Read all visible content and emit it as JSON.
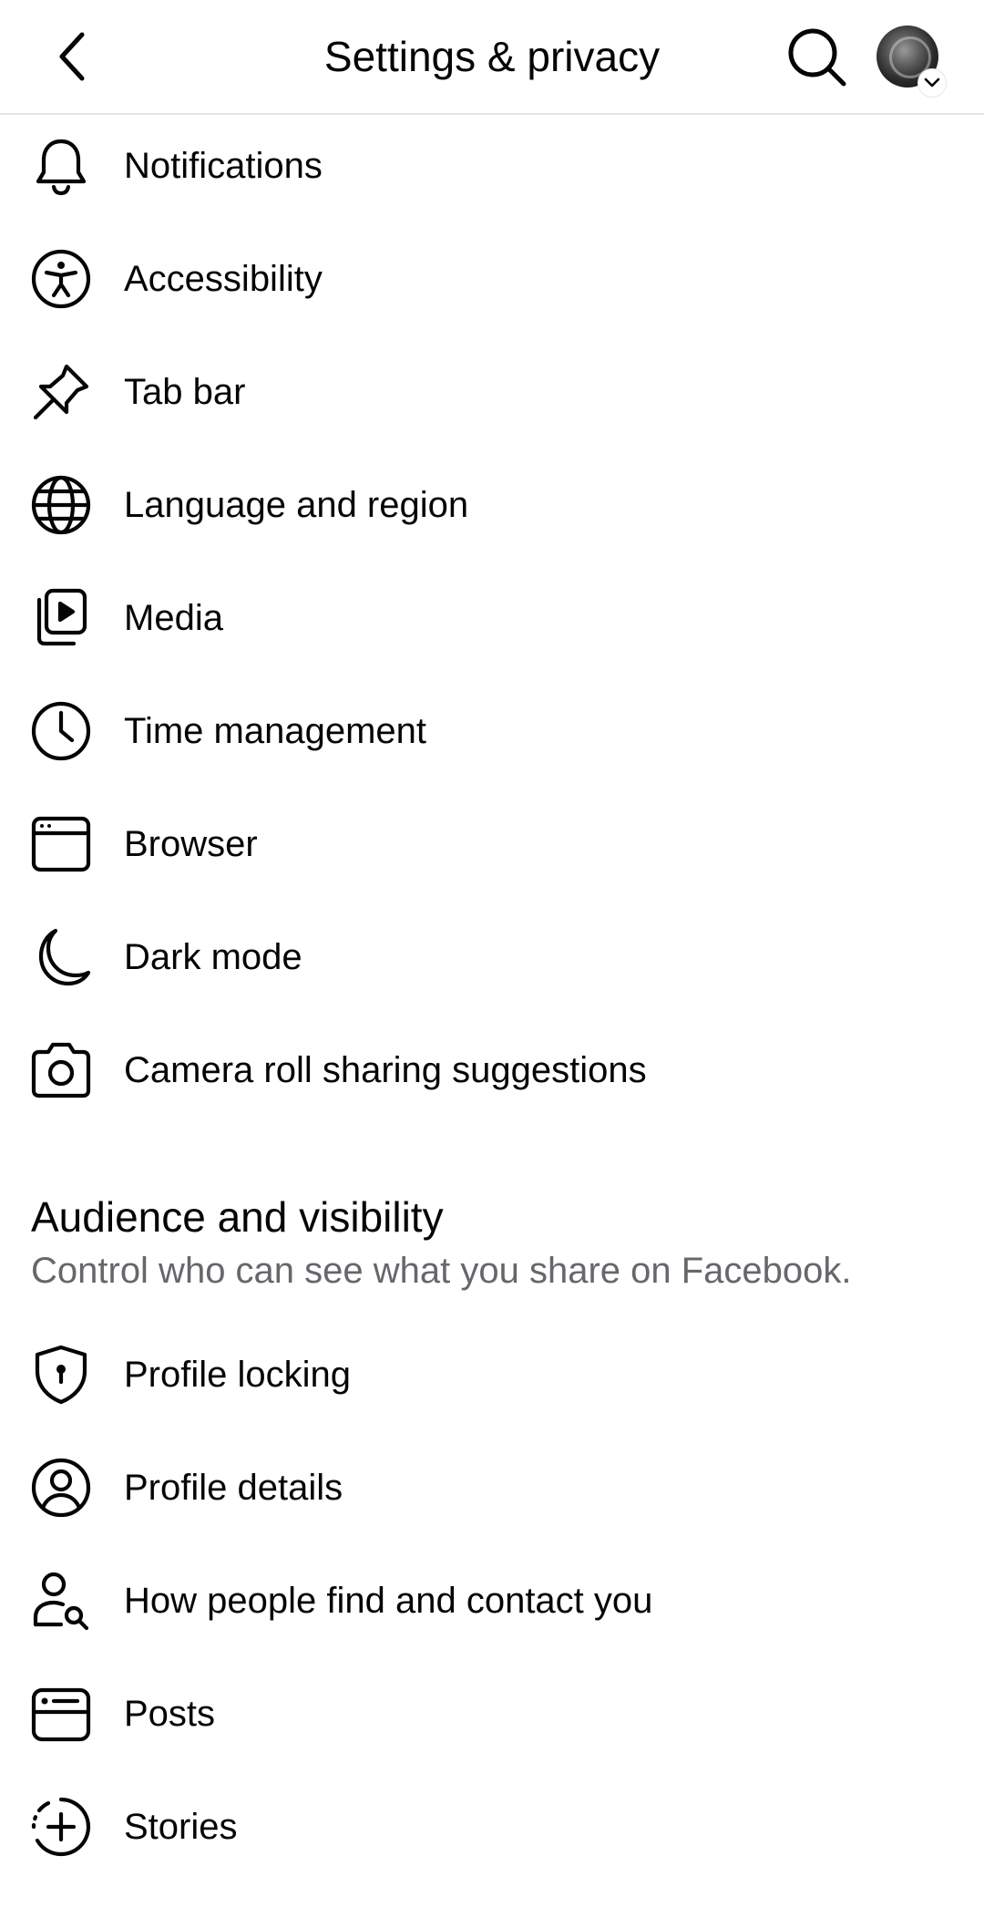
{
  "header": {
    "title": "Settings & privacy",
    "back_icon": "chevron-left-icon",
    "search_icon": "search-icon",
    "avatar_icon": "profile-avatar",
    "avatar_chevron_icon": "chevron-down-icon"
  },
  "preferences": {
    "items": [
      {
        "label": "Notifications",
        "icon": "bell-icon"
      },
      {
        "label": "Accessibility",
        "icon": "accessibility-icon"
      },
      {
        "label": "Tab bar",
        "icon": "pin-icon"
      },
      {
        "label": "Language and region",
        "icon": "globe-icon"
      },
      {
        "label": "Media",
        "icon": "media-icon"
      },
      {
        "label": "Time management",
        "icon": "clock-icon"
      },
      {
        "label": "Browser",
        "icon": "browser-icon"
      },
      {
        "label": "Dark mode",
        "icon": "moon-icon"
      },
      {
        "label": "Camera roll sharing suggestions",
        "icon": "camera-icon"
      }
    ]
  },
  "audience": {
    "title": "Audience and visibility",
    "subtitle": "Control who can see what you share on Facebook.",
    "items": [
      {
        "label": "Profile locking",
        "icon": "shield-lock-icon"
      },
      {
        "label": "Profile details",
        "icon": "user-circle-icon"
      },
      {
        "label": "How people find and contact you",
        "icon": "user-search-icon"
      },
      {
        "label": "Posts",
        "icon": "posts-icon"
      },
      {
        "label": "Stories",
        "icon": "stories-icon"
      }
    ]
  },
  "colors": {
    "text_primary": "#050505",
    "text_secondary": "#65676b",
    "divider": "#e4e6eb",
    "background": "#ffffff"
  }
}
